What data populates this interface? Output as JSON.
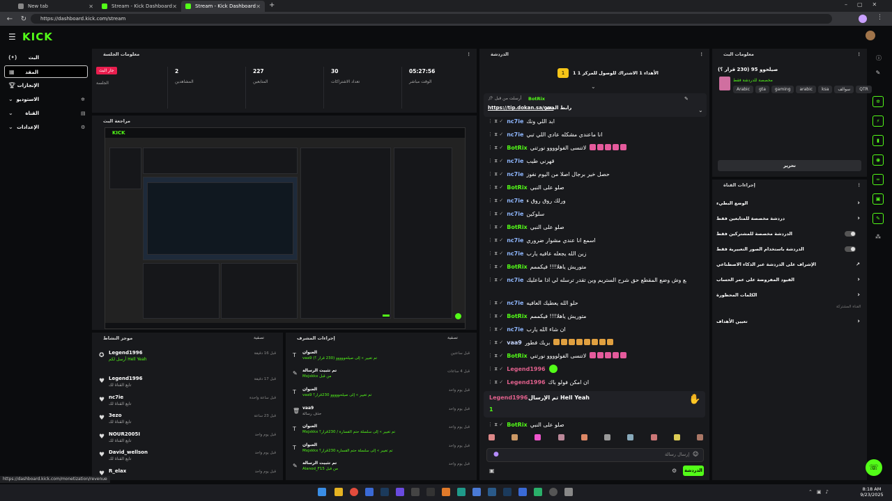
{
  "browser": {
    "tabs": [
      {
        "title": "New tab"
      },
      {
        "title": "Stream - Kick Dashboard"
      },
      {
        "title": "Stream - Kick Dashboard"
      }
    ],
    "url": "https://dashboard.kick.com/stream",
    "status_url": "https://dashboard.kick.com/monetization/revenue"
  },
  "logo": "KICK",
  "nav": [
    {
      "label": "البث",
      "icon": "live-icon"
    },
    {
      "label": "المقد",
      "icon": "dashboard-icon"
    },
    {
      "label": "الإنجازات",
      "icon": "trophy-icon"
    },
    {
      "label": "الاستوديو",
      "icon": "studio-icon"
    },
    {
      "label": "القناة",
      "icon": "channel-icon"
    },
    {
      "label": "الإعدادات",
      "icon": "gear-icon"
    }
  ],
  "session": {
    "title": "معلومات الجلسة",
    "live_badge": "جار البث",
    "session_label": "الجلسة",
    "stats": [
      {
        "value": "2",
        "label": "المشاهدين"
      },
      {
        "value": "227",
        "label": "المتابعين"
      },
      {
        "value": "30",
        "label": "تعداد الاشتراكات"
      },
      {
        "value": "05:27:56",
        "label": "الوقت مباشر"
      }
    ]
  },
  "preview": {
    "title": "مراجعة البث"
  },
  "activity": {
    "title": "موجز النشاط",
    "filter": "تصفية",
    "items": [
      {
        "name": "Legend1996",
        "sub": "أرسل لكم Hell Yeah",
        "time": "قبل 16 دقيقة"
      },
      {
        "name": "Legend1996",
        "sub": "تابع القناة لك",
        "time": "قبل 17 دقيقة"
      },
      {
        "name": "nc7ie",
        "sub": "تابع القناة لك",
        "time": "قبل ساعة واحدة"
      },
      {
        "name": "3ezo",
        "sub": "تابع القناة لك",
        "time": "قبل 23 ساعة"
      },
      {
        "name": "NOUR2005I",
        "sub": "تابع القناة لك",
        "time": "قبل يوم واحد"
      },
      {
        "name": "David_wellson",
        "sub": "تابع القناة لك",
        "time": "قبل يوم واحد"
      },
      {
        "name": "R_elax",
        "sub": "",
        "time": "قبل يوم واحد"
      }
    ]
  },
  "mod": {
    "title": "إجراءات المشرف",
    "filter": "تصفية",
    "items": [
      {
        "name": "العنوان",
        "sub": "vaa9 تم تغيير » إلى صيلحووووو (230 قرار ؟)",
        "time": "قبل ساعتين"
      },
      {
        "name": "تم تثبيت الرسالة",
        "sub": "Mxjxkkx من قبل",
        "time": "قبل 4 ساعات"
      },
      {
        "name": "العنوان",
        "sub": "vaa9 تم تغيير » إلى صيلحووووو 230قرار؟",
        "time": "قبل يوم واحد"
      },
      {
        "name": "vaa9",
        "sub": "حذف رسالة",
        "time": "قبل يوم واحد"
      },
      {
        "name": "العنوان",
        "sub": "Mxjxkkx تم تغيير » إلى سلسلة حتم القسارة / 230قرار؟",
        "time": "قبل يوم واحد"
      },
      {
        "name": "العنوان",
        "sub": "Mxjxkkx تم تغيير » إلى سلسلة حتم القسارة 230قرار؟",
        "time": "قبل يوم واحد"
      },
      {
        "name": "تم تثبيت الرسالة",
        "sub": "Alanod_F15 من قبل",
        "time": "قبل يوم واحد"
      }
    ]
  },
  "chat": {
    "title": "الدردشة",
    "goal": "1 الأهداء 1 الاشتراك للوصول للمركز 1",
    "pinned_user": "BotRix",
    "pinned_meta": "أرسلت من قبل",
    "pinned_title": "رابط الدعم",
    "pinned_link": "https://tip.dokan.sa/osu",
    "messages": [
      {
        "user": "nc7ie",
        "style": "",
        "text": "ابد اللي ونك"
      },
      {
        "user": "nc7ie",
        "style": "",
        "text": "انا ماعندي مشكله عادي اللي تبي"
      },
      {
        "user": "BotRix",
        "style": "green",
        "text": "لاتنسى الفولوووو نورتني"
      },
      {
        "user": "nc7ie",
        "style": "",
        "text": "قهرني طيب"
      },
      {
        "user": "nc7ie",
        "style": "",
        "text": "حصل خير برجال اصلا من اليوم نفوز"
      },
      {
        "user": "BotRix",
        "style": "green",
        "text": "صلو على النبي"
      },
      {
        "user": "nc7ie",
        "style": "",
        "text": "ورلك روق روق ء"
      },
      {
        "user": "nc7ie",
        "style": "",
        "text": "سلوكين"
      },
      {
        "user": "BotRix",
        "style": "green",
        "text": "صلو على النبي"
      },
      {
        "user": "nc7ie",
        "style": "",
        "text": "اسمع انا عندي مشوار ضروري"
      },
      {
        "user": "nc7ie",
        "style": "",
        "text": "زين الله يجعله عافيه يارب"
      },
      {
        "user": "BotRix",
        "style": "green",
        "text": "متوريش ياهلا!!! فيكممم"
      },
      {
        "user": "nc7ie",
        "style": "",
        "text": "المهم اسمع وش وضع المقطع حق شرح الستريم وين تقدر ترسله لي اذا ماعليك"
      },
      {
        "user": "nc7ie",
        "style": "",
        "text": "حلو الله يعطيك العافيه"
      },
      {
        "user": "BotRix",
        "style": "green",
        "text": "متوريش ياهلا!!! فيكممم"
      },
      {
        "user": "nc7ie",
        "style": "",
        "text": "ان شاء الله يارب"
      },
      {
        "user": "vaa9",
        "style": "ice",
        "text": "بريك فطور"
      },
      {
        "user": "BotRix",
        "style": "green",
        "text": "لاتنسى الفولوووو نورتني"
      },
      {
        "user": "Legend1996",
        "style": "pink",
        "text": ""
      },
      {
        "user": "Legend1996",
        "style": "pink",
        "text": "ان امكن فولو باك"
      }
    ],
    "gift_user": "Legend1996",
    "gift_text": "تم الإرسال Hell Yeah",
    "gift_count": "1",
    "last_message": {
      "user": "BotRix",
      "text": "صلو على النبي"
    },
    "input_placeholder": "إرسال رسالة",
    "send_label": "الدردشة"
  },
  "stream_info": {
    "title": "معلومات البث",
    "stream_title": "صيلحوو 95 (230 قرار ؟)",
    "category": "مخصصة للدردشة فقط",
    "tags": [
      "Arabic",
      "gta",
      "gaming",
      "arabic",
      "ksa",
      "سوالف",
      "QTR"
    ],
    "edit_label": "تحرير"
  },
  "channel_actions": {
    "title": "إجراءات القناة",
    "items": [
      {
        "label": "الوضع البطيء",
        "control": "chevron"
      },
      {
        "label": "دردشة مخصصة للمتابعين فقط",
        "control": "chevron"
      },
      {
        "label": "الدردشة مخصصة للمشتركين فقط",
        "control": "toggle"
      },
      {
        "label": "الدردشة باستخدام الصور التعبيرية فقط",
        "control": "toggle"
      },
      {
        "label": "الإشراف على الدردشة عبر الذكاء الاصطناعي",
        "control": "external"
      },
      {
        "label": "القيود المفروضة على عمر الحساب",
        "control": "chevron"
      },
      {
        "label": "الكلمات المحظورة",
        "control": "chevron"
      }
    ],
    "section_label": "القناة المشتركة",
    "goals_label": "تعيين الأهداف"
  },
  "system": {
    "time": "8:18 AM",
    "date": "9/23/2025"
  },
  "colors": {
    "accent": "#53fc18",
    "live": "#e91e4e",
    "panel": "#18191c",
    "bg": "#0b0c0e"
  }
}
